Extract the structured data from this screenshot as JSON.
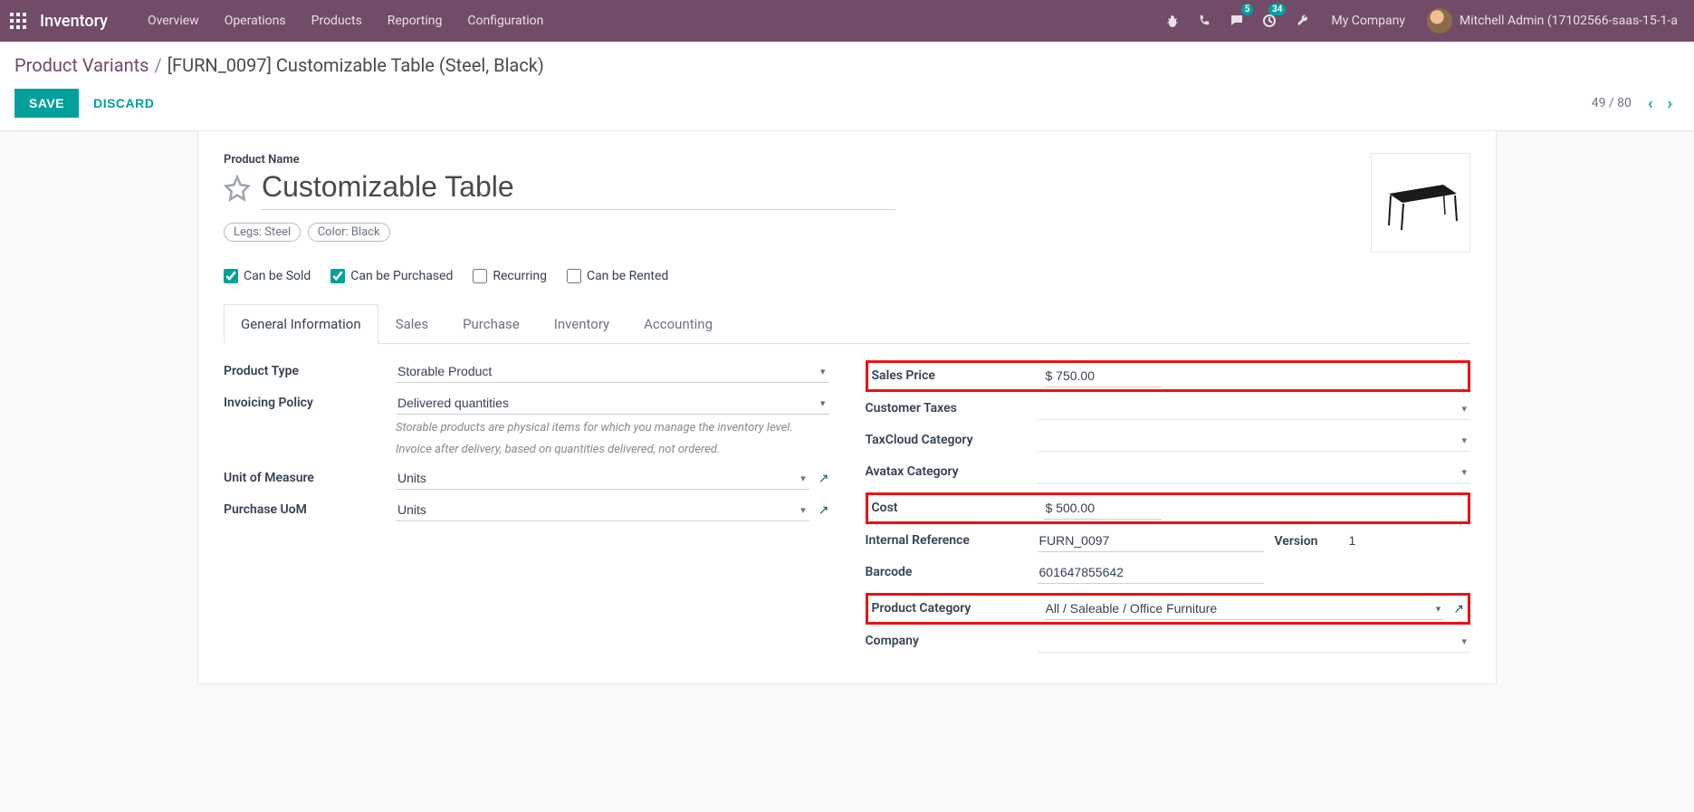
{
  "topbar": {
    "app": "Inventory",
    "menu": [
      "Overview",
      "Operations",
      "Products",
      "Reporting",
      "Configuration"
    ],
    "msg_badge": "5",
    "activity_badge": "34",
    "company": "My Company",
    "user": "Mitchell Admin (17102566-saas-15-1-a"
  },
  "breadcrumb": {
    "parent": "Product Variants",
    "current": "[FURN_0097] Customizable Table (Steel, Black)"
  },
  "actions": {
    "save": "SAVE",
    "discard": "DISCARD",
    "pager": "49 / 80"
  },
  "form": {
    "name_label": "Product Name",
    "name_value": "Customizable Table",
    "tags": [
      "Legs: Steel",
      "Color: Black"
    ],
    "checks": {
      "sold": "Can be Sold",
      "purchased": "Can be Purchased",
      "recurring": "Recurring",
      "rented": "Can be Rented"
    },
    "tabs": [
      "General Information",
      "Sales",
      "Purchase",
      "Inventory",
      "Accounting"
    ],
    "left": {
      "product_type": {
        "label": "Product Type",
        "value": "Storable Product"
      },
      "invoicing": {
        "label": "Invoicing Policy",
        "value": "Delivered quantities"
      },
      "help1": "Storable products are physical items for which you manage the inventory level.",
      "help2": "Invoice after delivery, based on quantities delivered, not ordered.",
      "uom": {
        "label": "Unit of Measure",
        "value": "Units"
      },
      "puom": {
        "label": "Purchase UoM",
        "value": "Units"
      }
    },
    "right": {
      "sales_price": {
        "label": "Sales Price",
        "value": "$ 750.00"
      },
      "cust_taxes": {
        "label": "Customer Taxes"
      },
      "taxcloud": {
        "label": "TaxCloud Category"
      },
      "avatax": {
        "label": "Avatax Category"
      },
      "cost": {
        "label": "Cost",
        "value": "$ 500.00"
      },
      "internal_ref": {
        "label": "Internal Reference",
        "value": "FURN_0097"
      },
      "version": {
        "label": "Version",
        "value": "1"
      },
      "barcode": {
        "label": "Barcode",
        "value": "601647855642"
      },
      "category": {
        "label": "Product Category",
        "value": "All / Saleable / Office Furniture"
      },
      "company": {
        "label": "Company"
      }
    }
  }
}
